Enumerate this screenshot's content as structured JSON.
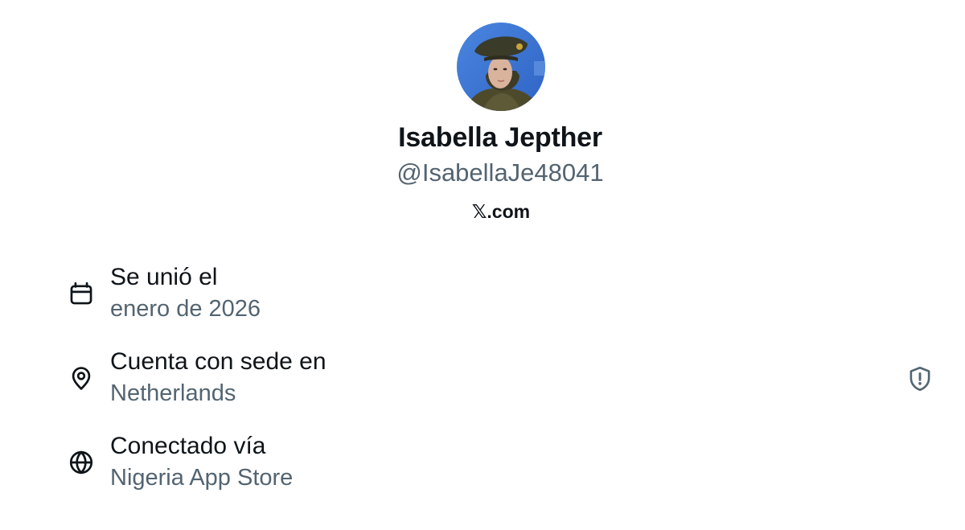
{
  "profile": {
    "name": "Isabella Jepther",
    "handle": "@IsabellaJe48041",
    "site_glyph": "𝕏",
    "site_suffix": ".com"
  },
  "details": [
    {
      "label": "Se unió el",
      "value": "enero de 2026",
      "icon": "calendar-icon"
    },
    {
      "label": "Cuenta con sede en",
      "value": "Netherlands",
      "icon": "location-pin-icon"
    },
    {
      "label": "Conectado vía",
      "value": "Nigeria App Store",
      "icon": "globe-icon"
    }
  ],
  "indicators": {
    "location_warning_icon": "shield-alert-icon"
  },
  "colors": {
    "primary_text": "#0f1419",
    "secondary_text": "#536471",
    "background": "#ffffff",
    "avatar_bg": "#3a78d6"
  }
}
